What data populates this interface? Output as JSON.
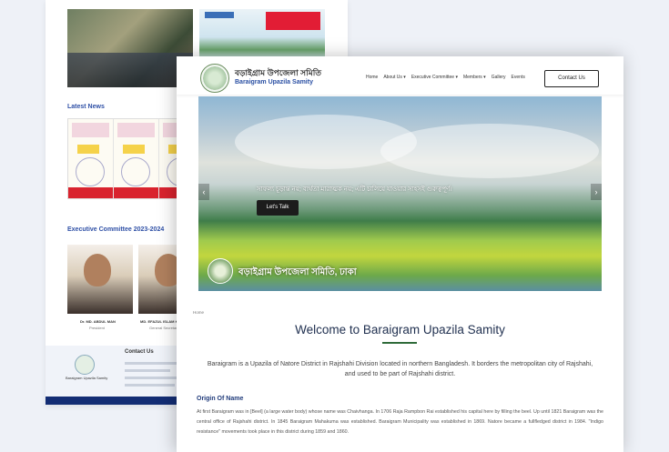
{
  "back": {
    "latest_news": "Latest News",
    "committee_title": "Executive Committee 2023-2024",
    "members": [
      {
        "name": "Dr. MD. ABDUL MAN",
        "role": "President"
      },
      {
        "name": "MD. EFAZUL ISLAM K.",
        "role": "General Secretary"
      }
    ],
    "contact_title": "Contact Us",
    "contact_org": "Baraigram Upazila Samity"
  },
  "header": {
    "brand_bn": "বড়াইগ্রাম উপজেলা সমিতি",
    "brand_en": "Baraigram Upazila Samity",
    "nav": [
      "Home",
      "About Us ▾",
      "Executive Committee ▾",
      "Members ▾",
      "Gallery",
      "Events"
    ],
    "contact_button": "Contact Us"
  },
  "hero": {
    "slogan": "সাফল্য চূড়ান্ত নয়; ব্যর্থতা মারাত্মক নয়; এটি চালিয়ে যাওয়ার সাহসই গুরুত্বপূর্ণ।",
    "cta": "Let's Talk",
    "seal_text": "বড়াইগ্রাম উপজেলা সমিতি, ঢাকা",
    "prev": "‹",
    "next": "›"
  },
  "main": {
    "breadcrumb": "Home",
    "title": "Welcome to Baraigram Upazila Samity",
    "intro": "Baraigram is a Upazila of Natore District in Rajshahi Division located in northern Bangladesh. It borders the metropolitan city of Rajshahi, and used to be part of Rajshahi district.",
    "origin_heading": "Origin Of Name",
    "origin_text": "At first Baraigram was in [Beel] (a large water body) whose name was Chaivhanga. In 1706 Raja Rampbon Rai established his capital here by filling the beel. Up until 1821 Baraigram was the central office of Rajshahi district. In 1845 Baraigram Mahakuma was established. Baraigram Municipality was established in 1869. Natore became a fullfledged district in 1984. \"Indigo resistance\" movements took place in this district during 1859 and 1860."
  },
  "colors": {
    "brand_blue": "#2a4fa3",
    "heading": "#1f2f4f",
    "accent_green": "#2f6b3a"
  }
}
